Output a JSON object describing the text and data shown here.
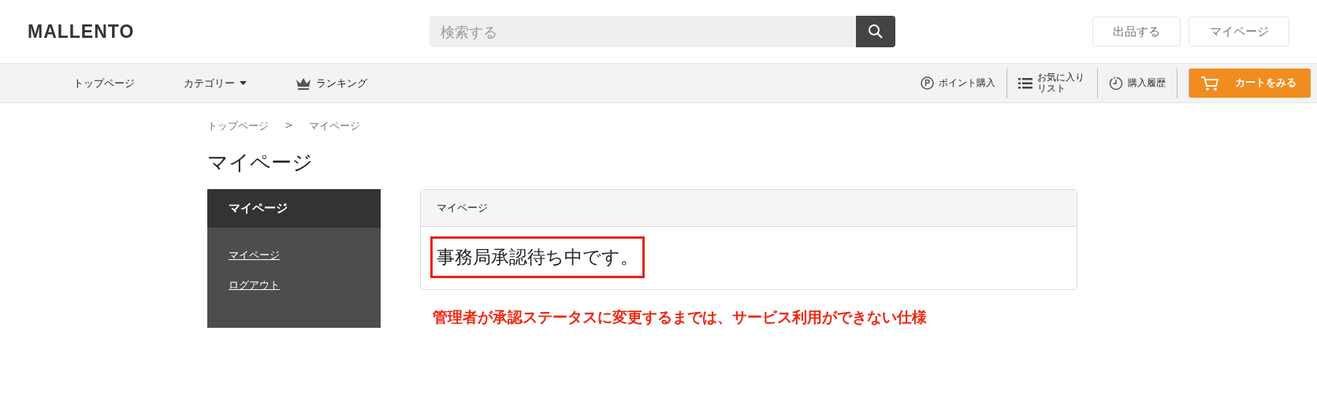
{
  "header": {
    "logo": "MALLENTO",
    "search": {
      "placeholder": "検索する"
    },
    "buttons": [
      "出品する",
      "マイページ"
    ]
  },
  "nav": {
    "left": [
      {
        "label": "トップページ",
        "kind": "plain"
      },
      {
        "label": "カテゴリー",
        "kind": "dropdown"
      },
      {
        "label": "ランキング",
        "kind": "crown"
      }
    ],
    "right": [
      {
        "label": "ポイント購入",
        "kind": "points"
      },
      {
        "label": "お気に入りリスト",
        "kind": "list"
      },
      {
        "label": "購入履歴",
        "kind": "history"
      },
      {
        "label": "カートをみる",
        "kind": "cart"
      }
    ]
  },
  "breadcrumb": [
    "トップページ",
    ">",
    "マイページ"
  ],
  "page_title": "マイページ",
  "sidebar": {
    "title": "マイページ",
    "items": [
      "マイページ",
      "ログアウト"
    ]
  },
  "card": {
    "title": "マイページ",
    "message": "事務局承認待ち中です。"
  },
  "annotation": "管理者が承認ステータスに変更するまでは、サービス利用ができない仕様"
}
